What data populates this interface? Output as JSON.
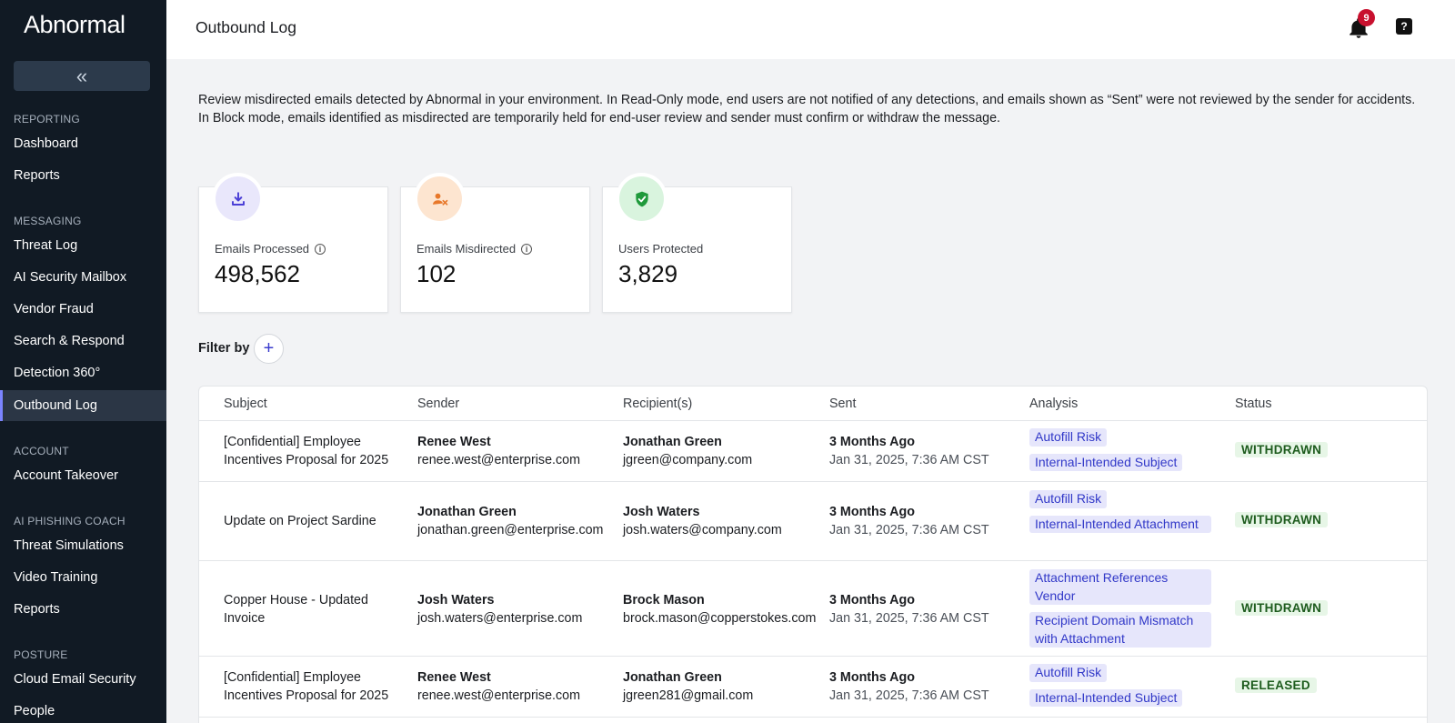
{
  "app": {
    "logo_text": "Abnormal",
    "collapse_icon": "«"
  },
  "sidebar": {
    "sections": [
      {
        "label": "REPORTING"
      },
      {
        "label": "MESSAGING"
      },
      {
        "label": "ACCOUNT"
      },
      {
        "label": "AI PHISHING COACH"
      },
      {
        "label": "POSTURE"
      }
    ],
    "items": [
      {
        "label": "Dashboard"
      },
      {
        "label": "Reports"
      },
      {
        "label": "Threat Log"
      },
      {
        "label": "AI Security Mailbox"
      },
      {
        "label": "Vendor Fraud"
      },
      {
        "label": "Search & Respond"
      },
      {
        "label": "Detection 360°"
      },
      {
        "label": "Outbound Log"
      },
      {
        "label": "Account Takeover"
      },
      {
        "label": "Threat Simulations"
      },
      {
        "label": "Video Training"
      },
      {
        "label": "Reports"
      },
      {
        "label": "Cloud Email Security"
      },
      {
        "label": "People"
      }
    ],
    "active_item": "Outbound Log",
    "accent_color": "#7b84ff"
  },
  "header": {
    "title": "Outbound Log",
    "notification_count": "9",
    "help_label": "?"
  },
  "description": "Review misdirected emails detected by Abnormal in your environment. In Read-Only mode, end users are not notified of any detections, and emails shown as “Sent” were not reviewed by the sender for accidents. In Block mode, emails identified as misdirected are temporarily held for end-user review and sender must confirm or withdraw the message.",
  "stats": [
    {
      "label": "Emails Processed",
      "value": "498,562",
      "icon": "download-icon",
      "icon_bg": "#e9e7fb",
      "icon_color": "#4b3fd6",
      "has_info": true
    },
    {
      "label": "Emails Misdirected",
      "value": "102",
      "icon": "user-x-icon",
      "icon_bg": "#fde5d0",
      "icon_color": "#e8782a",
      "has_info": true
    },
    {
      "label": "Users Protected",
      "value": "3,829",
      "icon": "shield-check-icon",
      "icon_bg": "#d9f4de",
      "icon_color": "#1f9a3b",
      "has_info": false
    }
  ],
  "filter": {
    "label": "Filter by",
    "add_icon": "+"
  },
  "table": {
    "columns": [
      "Subject",
      "Sender",
      "Recipient(s)",
      "Sent",
      "Analysis",
      "Status"
    ],
    "rows": [
      {
        "subject": "[Confidential] Employee Incentives Proposal for 2025",
        "sender_name": "Renee West",
        "sender_email": "renee.west@enterprise.com",
        "recipient_name": "Jonathan Green",
        "recipient_email": "jgreen@company.com",
        "sent_relative": "3 Months Ago",
        "sent_date": "Jan 31, 2025, 7:36 AM CST",
        "analysis": [
          "Autofill Risk",
          "Internal-Intended Subject"
        ],
        "status": "WITHDRAWN"
      },
      {
        "subject": "Update on Project Sardine",
        "sender_name": "Jonathan Green",
        "sender_email": "jonathan.green@enterprise.com",
        "recipient_name": "Josh Waters",
        "recipient_email": "josh.waters@company.com",
        "sent_relative": "3 Months Ago",
        "sent_date": "Jan 31, 2025, 7:36 AM CST",
        "analysis": [
          "Autofill Risk",
          "Internal-Intended Attachment"
        ],
        "status": "WITHDRAWN"
      },
      {
        "subject": "Copper House - Updated Invoice",
        "sender_name": "Josh Waters",
        "sender_email": "josh.waters@enterprise.com",
        "recipient_name": "Brock Mason",
        "recipient_email": "brock.mason@copperstokes.com",
        "sent_relative": "3 Months Ago",
        "sent_date": "Jan 31, 2025, 7:36 AM CST",
        "analysis": [
          "Attachment References Vendor",
          "Recipient Domain Mismatch with Attachment"
        ],
        "status": "WITHDRAWN"
      },
      {
        "subject": "[Confidential] Employee Incentives Proposal for 2025",
        "sender_name": "Renee West",
        "sender_email": "renee.west@enterprise.com",
        "recipient_name": "Jonathan Green",
        "recipient_email": "jgreen281@gmail.com",
        "sent_relative": "3 Months Ago",
        "sent_date": "Jan 31, 2025, 7:36 AM CST",
        "analysis": [
          "Autofill Risk",
          "Internal-Intended Subject"
        ],
        "status": "RELEASED"
      }
    ]
  }
}
